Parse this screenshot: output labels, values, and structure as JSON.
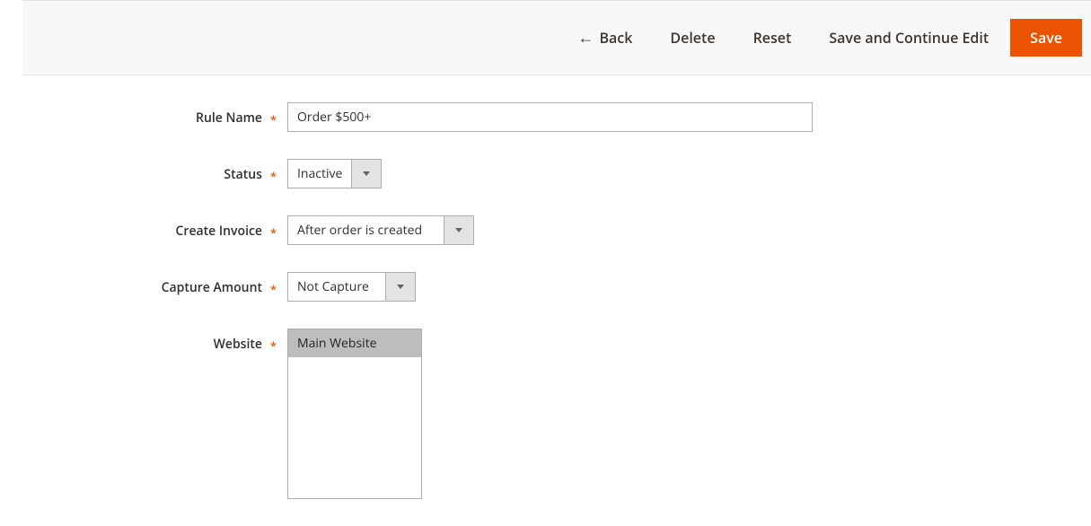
{
  "toolbar": {
    "back": "Back",
    "delete": "Delete",
    "reset": "Reset",
    "save_continue": "Save and Continue Edit",
    "save": "Save"
  },
  "form": {
    "rule_name": {
      "label": "Rule Name",
      "value": "Order $500+"
    },
    "status": {
      "label": "Status",
      "value": "Inactive"
    },
    "create_invoice": {
      "label": "Create Invoice",
      "value": "After order is created"
    },
    "capture_amount": {
      "label": "Capture Amount",
      "value": "Not Capture"
    },
    "website": {
      "label": "Website",
      "options": [
        "Main Website"
      ],
      "selected": "Main Website"
    }
  }
}
